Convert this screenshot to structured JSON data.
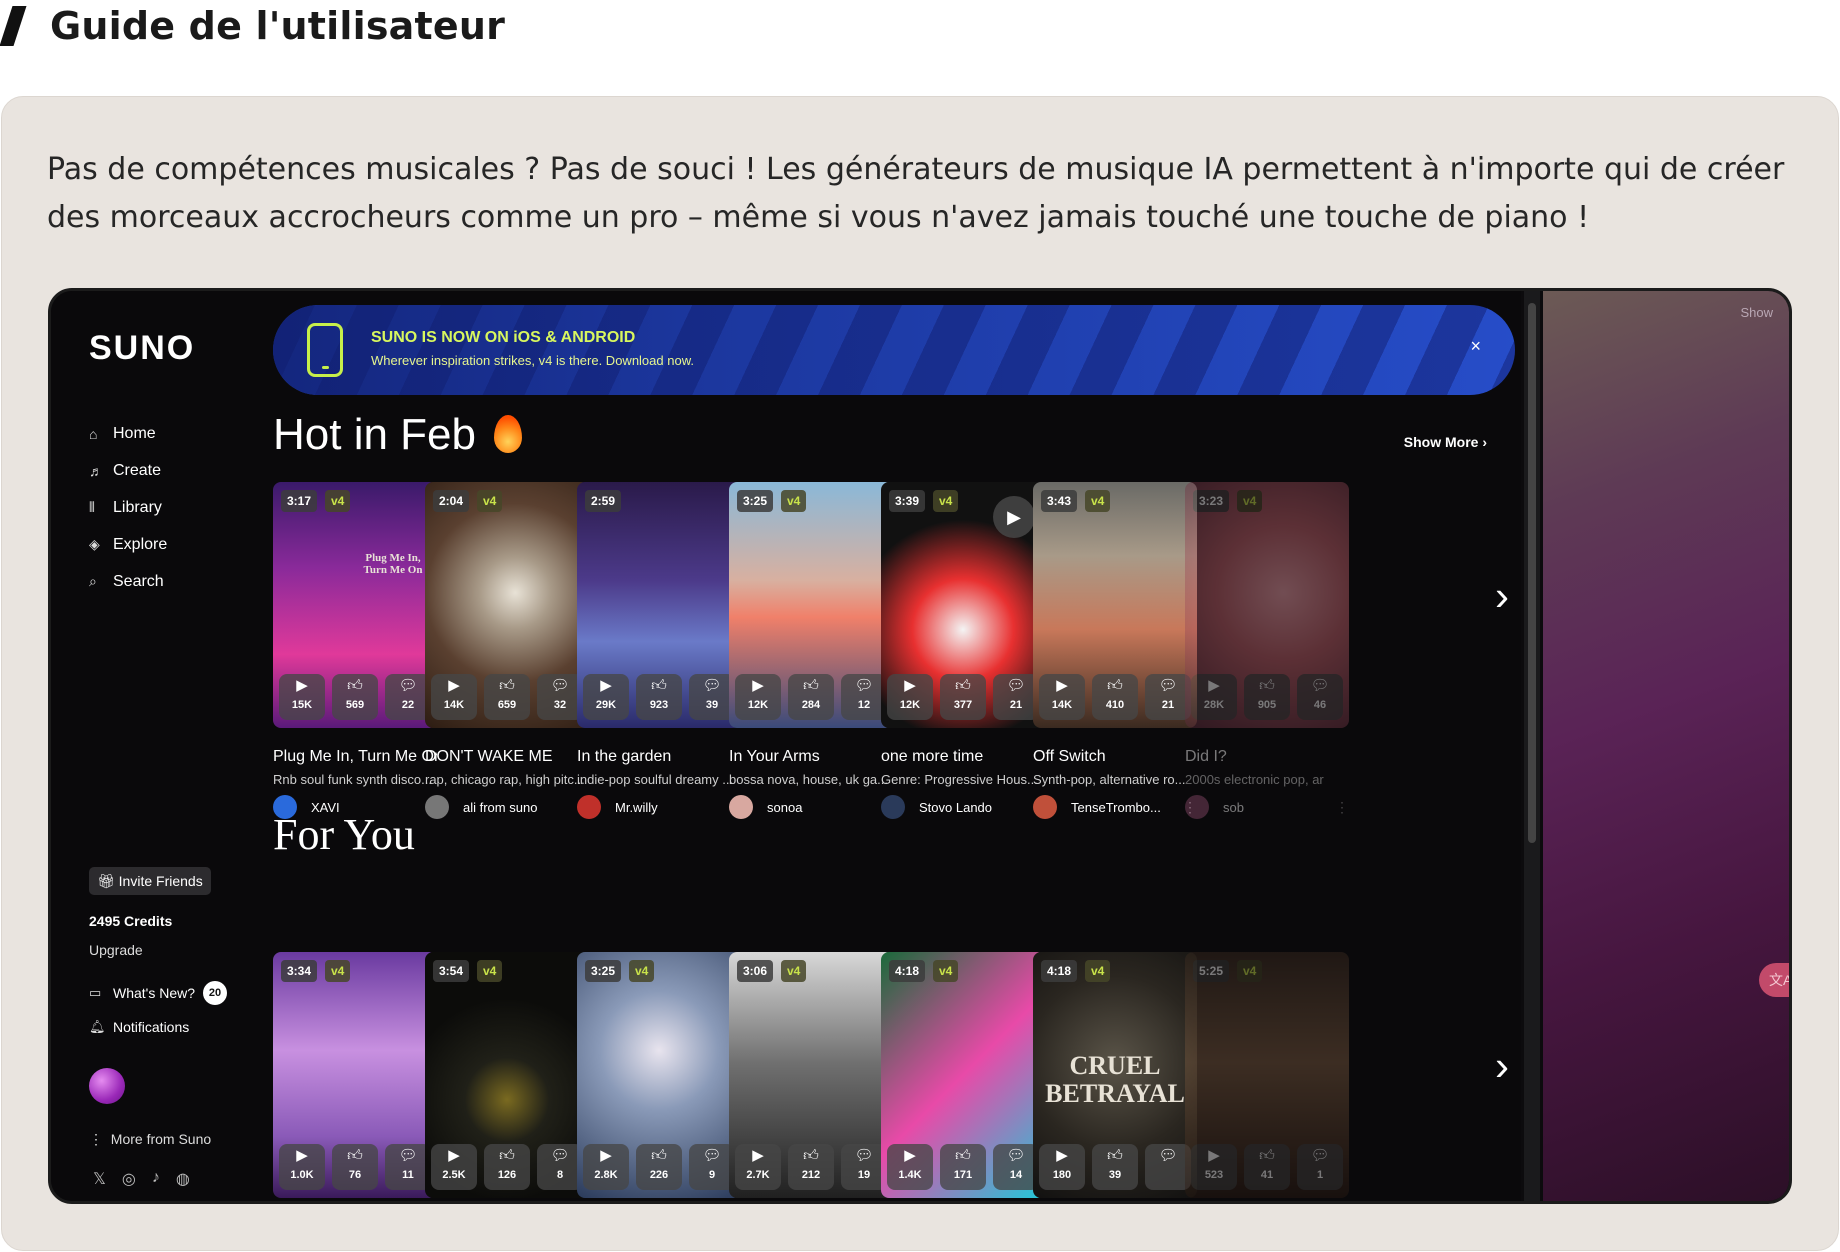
{
  "heading": "Guide de l'utilisateur",
  "intro": "Pas de compétences musicales ? Pas de souci ! Les générateurs de musique IA permettent à n'importe qui de créer des morceaux accrocheurs comme un pro – même si vous n'avez jamais touché une touche de piano !",
  "app": {
    "logo": "SUNO",
    "nav": [
      {
        "icon": "⌂",
        "label": "Home"
      },
      {
        "icon": "♬",
        "label": "Create"
      },
      {
        "icon": "⫴",
        "label": "Library"
      },
      {
        "icon": "◈",
        "label": "Explore"
      },
      {
        "icon": "⌕",
        "label": "Search"
      }
    ],
    "invite_label": "Invite Friends",
    "credits": "2495 Credits",
    "upgrade": "Upgrade",
    "whats_new": "What's New?",
    "whats_new_count": "20",
    "notifications": "Notifications",
    "more": "More from Suno",
    "banner": {
      "title": "SUNO IS NOW ON iOS & ANDROID",
      "subtitle": "Wherever inspiration strikes, v4 is there. Download now.",
      "close": "×"
    },
    "side_panel_show": "Show",
    "hot_title": "Hot in Feb",
    "show_more": "Show More",
    "for_you_title": "For You",
    "colors": {
      "accent": "#d8f75e",
      "banner_blue": "#2a55d8",
      "bg": "#0a090b"
    },
    "hot": [
      {
        "dur": "3:17",
        "v": "v4",
        "plays": "15K",
        "likes": "569",
        "comments": "22",
        "title": "Plug Me In, Turn Me On",
        "genre": "Rnb soul funk synth disco...",
        "author": "XAVI",
        "art_text": "Plug Me In, Turn Me On"
      },
      {
        "dur": "2:04",
        "v": "v4",
        "plays": "14K",
        "likes": "659",
        "comments": "32",
        "title": "DON'T WAKE ME",
        "genre": "rap, chicago rap, high pitc...",
        "author": "ali from suno"
      },
      {
        "dur": "2:59",
        "v": "",
        "plays": "29K",
        "likes": "923",
        "comments": "39",
        "title": "In the garden",
        "genre": "indie-pop soulful dreamy ...",
        "author": "Mr.willy"
      },
      {
        "dur": "3:25",
        "v": "v4",
        "plays": "12K",
        "likes": "284",
        "comments": "12",
        "title": "In Your Arms",
        "genre": "bossa nova, house, uk ga...",
        "author": "sonoa"
      },
      {
        "dur": "3:39",
        "v": "v4",
        "plays": "12K",
        "likes": "377",
        "comments": "21",
        "title": "one more time",
        "genre": "Genre: Progressive Hous...",
        "author": "Stovo Lando"
      },
      {
        "dur": "3:43",
        "v": "v4",
        "plays": "14K",
        "likes": "410",
        "comments": "21",
        "title": "Off Switch",
        "genre": "Synth-pop, alternative ro...",
        "author": "TenseTrombo..."
      },
      {
        "dur": "3:23",
        "v": "v4",
        "plays": "28K",
        "likes": "905",
        "comments": "46",
        "title": "Did I?",
        "genre": "2000s electronic pop, ar",
        "author": "sob"
      }
    ],
    "foryou": [
      {
        "dur": "3:34",
        "v": "v4",
        "plays": "1.0K",
        "likes": "76",
        "comments": "11"
      },
      {
        "dur": "3:54",
        "v": "v4",
        "plays": "2.5K",
        "likes": "126",
        "comments": "8"
      },
      {
        "dur": "3:25",
        "v": "v4",
        "plays": "2.8K",
        "likes": "226",
        "comments": "9"
      },
      {
        "dur": "3:06",
        "v": "v4",
        "plays": "2.7K",
        "likes": "212",
        "comments": "19"
      },
      {
        "dur": "4:18",
        "v": "v4",
        "plays": "1.4K",
        "likes": "171",
        "comments": "14"
      },
      {
        "dur": "4:18",
        "v": "v4",
        "plays": "180",
        "likes": "39",
        "comments": "",
        "art_text": "CRUEL BETRAYAL"
      },
      {
        "dur": "5:25",
        "v": "v4",
        "plays": "523",
        "likes": "41",
        "comments": "1"
      }
    ]
  }
}
